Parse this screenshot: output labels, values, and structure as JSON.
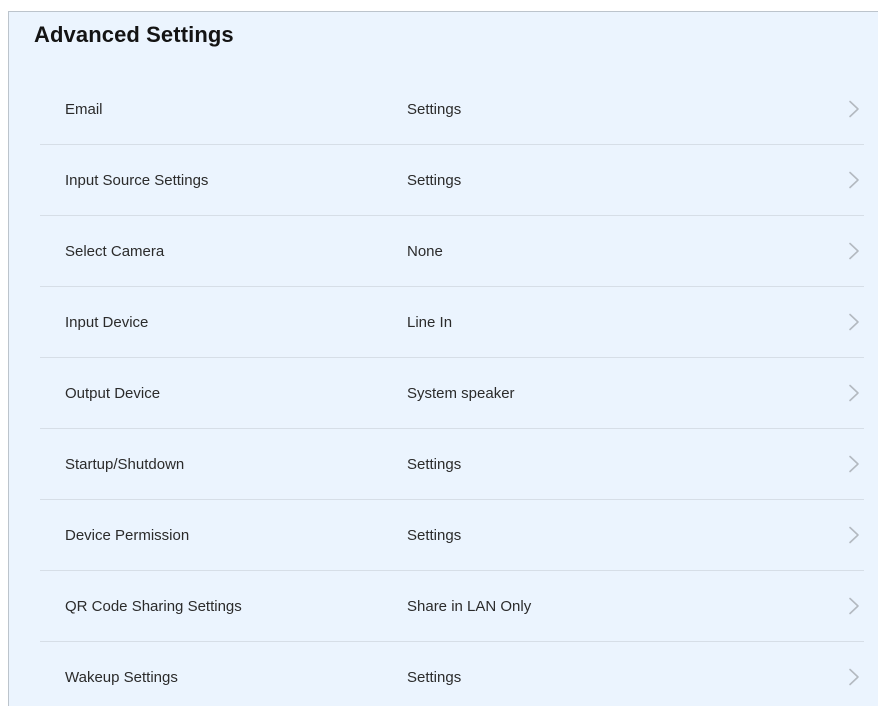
{
  "page": {
    "title": "Advanced Settings"
  },
  "colors": {
    "panel_background": "#ebf4fe",
    "divider": "#d6dee7",
    "chevron": "#b3b9c0",
    "text": "#2b2b2b"
  },
  "settings": {
    "items": [
      {
        "label": "Email",
        "value": "Settings",
        "icon": "chevron-right-icon"
      },
      {
        "label": "Input Source Settings",
        "value": "Settings",
        "icon": "chevron-right-icon"
      },
      {
        "label": "Select Camera",
        "value": "None",
        "icon": "chevron-right-icon"
      },
      {
        "label": "Input Device",
        "value": "Line In",
        "icon": "chevron-right-icon"
      },
      {
        "label": "Output Device",
        "value": "System speaker",
        "icon": "chevron-right-icon"
      },
      {
        "label": "Startup/Shutdown",
        "value": "Settings",
        "icon": "chevron-right-icon"
      },
      {
        "label": "Device Permission",
        "value": "Settings",
        "icon": "chevron-right-icon"
      },
      {
        "label": "QR Code Sharing Settings",
        "value": "Share in LAN Only",
        "icon": "chevron-right-icon"
      },
      {
        "label": "Wakeup Settings",
        "value": "Settings",
        "icon": "chevron-right-icon"
      }
    ]
  }
}
